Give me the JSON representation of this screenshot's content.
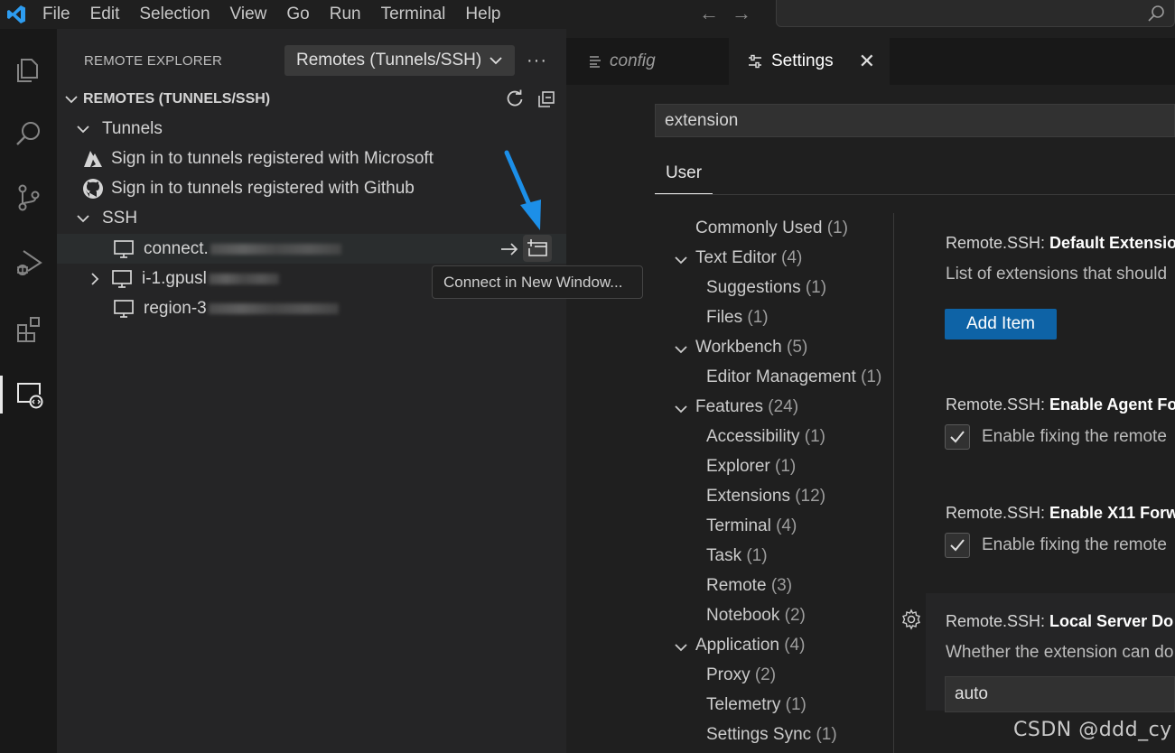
{
  "menu": [
    "File",
    "Edit",
    "Selection",
    "View",
    "Go",
    "Run",
    "Terminal",
    "Help"
  ],
  "sidebar": {
    "title": "REMOTE EXPLORER",
    "select": "Remotes (Tunnels/SSH)",
    "more": "···",
    "section": "REMOTES (TUNNELS/SSH)",
    "tunnels_label": "Tunnels",
    "tunnel_ms": "Sign in to tunnels registered with Microsoft",
    "tunnel_gh": "Sign in to tunnels registered with Github",
    "ssh_label": "SSH",
    "hosts": [
      "connect.",
      "i-1.gpusl",
      "region-3"
    ]
  },
  "tooltip": "Connect in New Window...",
  "tabs": {
    "config": "config",
    "settings": "Settings"
  },
  "settings": {
    "search": "extension",
    "scope_tab": "User",
    "toc": [
      {
        "label": "Commonly Used",
        "count": "(1)",
        "level": 0
      },
      {
        "label": "Text Editor",
        "count": "(4)",
        "level": 0,
        "expanded": true
      },
      {
        "label": "Suggestions",
        "count": "(1)",
        "level": 1
      },
      {
        "label": "Files",
        "count": "(1)",
        "level": 1
      },
      {
        "label": "Workbench",
        "count": "(5)",
        "level": 0,
        "expanded": true
      },
      {
        "label": "Editor Management",
        "count": "(1)",
        "level": 1
      },
      {
        "label": "Features",
        "count": "(24)",
        "level": 0,
        "expanded": true
      },
      {
        "label": "Accessibility",
        "count": "(1)",
        "level": 1
      },
      {
        "label": "Explorer",
        "count": "(1)",
        "level": 1
      },
      {
        "label": "Extensions",
        "count": "(12)",
        "level": 1
      },
      {
        "label": "Terminal",
        "count": "(4)",
        "level": 1
      },
      {
        "label": "Task",
        "count": "(1)",
        "level": 1
      },
      {
        "label": "Remote",
        "count": "(3)",
        "level": 1
      },
      {
        "label": "Notebook",
        "count": "(2)",
        "level": 1
      },
      {
        "label": "Application",
        "count": "(4)",
        "level": 0,
        "expanded": true
      },
      {
        "label": "Proxy",
        "count": "(2)",
        "level": 1
      },
      {
        "label": "Telemetry",
        "count": "(1)",
        "level": 1
      },
      {
        "label": "Settings Sync",
        "count": "(1)",
        "level": 1
      }
    ],
    "items": [
      {
        "prefix": "Remote.SSH: ",
        "name": "Default Extensio",
        "desc": "List of extensions that should"
      },
      {
        "prefix": "Remote.SSH: ",
        "name": "Enable Agent Fo",
        "desc": "Enable fixing the remote"
      },
      {
        "prefix": "Remote.SSH: ",
        "name": "Enable X11 Forw",
        "desc": "Enable fixing the remote"
      },
      {
        "prefix": "Remote.SSH: ",
        "name": "Local Server Do",
        "desc": "Whether the extension can do"
      }
    ],
    "add_item": "Add Item",
    "dropdown_value": "auto"
  },
  "watermark": "CSDN @ddd_cy"
}
